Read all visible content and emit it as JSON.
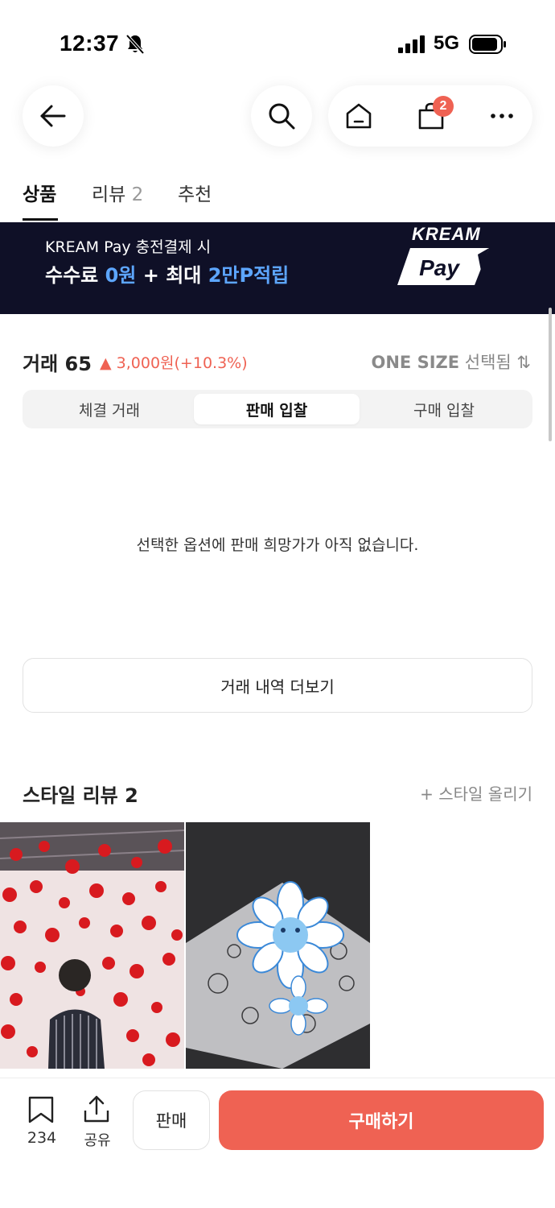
{
  "status_bar": {
    "time": "12:37",
    "network": "5G"
  },
  "header": {
    "cart_count": "2"
  },
  "tabs": [
    {
      "label": "상품",
      "count": ""
    },
    {
      "label": "리뷰",
      "count": "2"
    },
    {
      "label": "추천",
      "count": ""
    }
  ],
  "banner": {
    "line1": "KREAM Pay 충전결제 시",
    "line2_a": "수수료 ",
    "line2_hl1": "0원",
    "line2_b": " + 최대 ",
    "line2_hl2": "2만P적립",
    "logo_top": "KREAM",
    "logo_bottom": "Pay"
  },
  "trade": {
    "title": "거래 65",
    "change": "▲ 3,000원(+10.3%)",
    "size_value": "ONE SIZE",
    "size_suffix": " 선택됨 ⇅"
  },
  "segments": [
    {
      "label": "체결 거래",
      "active": false
    },
    {
      "label": "판매 입찰",
      "active": true
    },
    {
      "label": "구매 입찰",
      "active": false
    }
  ],
  "empty_message": "선택한 옵션에 판매 희망가가 아직 없습니다.",
  "more_button": "거래 내역 더보기",
  "style_review": {
    "title": "스타일 리뷰 2",
    "upload": "+ 스타일 올리기"
  },
  "bottom": {
    "bookmark_count": "234",
    "share_label": "공유",
    "sell_label": "판매",
    "buy_label": "구매하기"
  },
  "colors": {
    "accent": "#ef6253",
    "banner_bg": "#0f1027",
    "banner_highlight": "#5da6ff"
  }
}
